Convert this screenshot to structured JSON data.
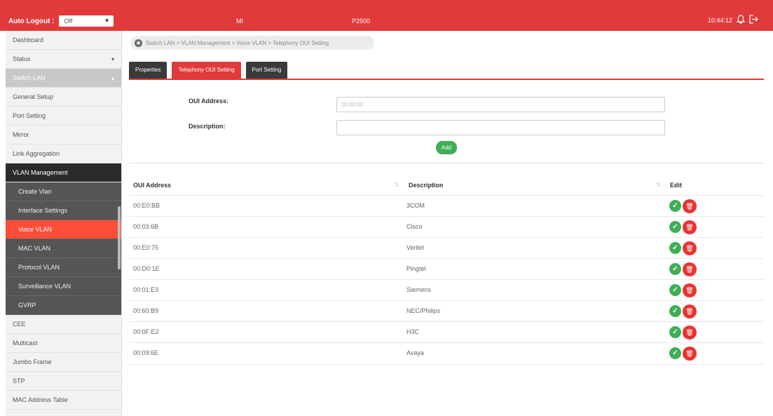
{
  "header": {
    "auto_logout_label": "Auto Logout :",
    "auto_logout_value": "Off",
    "mid_text_1": "MI",
    "mid_text_2": "P2500",
    "time": "10:44:12",
    "bell_icon": "bell-icon",
    "logout_icon": "logout-icon"
  },
  "sidebar": {
    "items": [
      {
        "label": "Dashboard"
      },
      {
        "label": "Status"
      },
      {
        "label": "Switch LAN"
      },
      {
        "label": "General Setup"
      },
      {
        "label": "Port Setting"
      },
      {
        "label": "Mirror"
      },
      {
        "label": "Link Aggregation"
      },
      {
        "label": "VLAN Management"
      },
      {
        "label": "Create Vlan"
      },
      {
        "label": "Interface Settings"
      },
      {
        "label": "Voice VLAN"
      },
      {
        "label": "MAC VLAN"
      },
      {
        "label": "Protocol VLAN"
      },
      {
        "label": "Surveillance VLAN"
      },
      {
        "label": "GVRP"
      },
      {
        "label": "CEE"
      },
      {
        "label": "Multicast"
      },
      {
        "label": "Jumbo Frame"
      },
      {
        "label": "STP"
      },
      {
        "label": "MAC Address Table"
      }
    ]
  },
  "breadcrumb": "Switch LAN > VLAN Management > Voice VLAN > Telephony OUI Setting",
  "tabs": [
    {
      "label": "Properties"
    },
    {
      "label": "Telephony OUI Setting"
    },
    {
      "label": "Port Setting"
    }
  ],
  "form": {
    "oui_label": "OUI Address:",
    "oui_placeholder": "00:00:00",
    "desc_label": "Description:",
    "desc_placeholder": "",
    "add_label": "Add"
  },
  "table": {
    "headers": [
      "OUI Address",
      "Description",
      "Edit"
    ],
    "rows": [
      {
        "oui": "00:E0:BB",
        "desc": "3COM"
      },
      {
        "oui": "00:03:6B",
        "desc": "Cisco"
      },
      {
        "oui": "00:E0:75",
        "desc": "Veritel"
      },
      {
        "oui": "00:D0:1E",
        "desc": "Pingtel"
      },
      {
        "oui": "00:01:E3",
        "desc": "Siemens"
      },
      {
        "oui": "00:60:B9",
        "desc": "NEC/Philips"
      },
      {
        "oui": "00:0F:E2",
        "desc": "H3C"
      },
      {
        "oui": "00:09:6E",
        "desc": "Avaya"
      }
    ]
  },
  "colors": {
    "brand_red": "#e03a3a",
    "active_item": "#ff4d3a",
    "confirm_green": "#3fae55",
    "delete_red": "#e8342f"
  }
}
